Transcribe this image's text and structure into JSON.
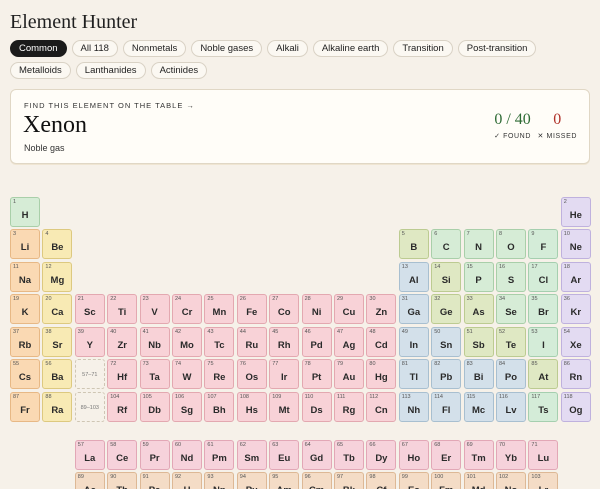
{
  "app": {
    "title": "Element Hunter"
  },
  "filters": [
    "Common",
    "All 118",
    "Nonmetals",
    "Noble gases",
    "Alkali",
    "Alkaline earth",
    "Transition",
    "Post-transition",
    "Metalloids",
    "Lanthanides",
    "Actinides"
  ],
  "active_filter": "Common",
  "quiz": {
    "prompt": "FIND THIS ELEMENT ON THE TABLE →",
    "element_name": "Xenon",
    "element_category": "Noble gas",
    "found_score": "0 / 40",
    "found_label": "✓ FOUND",
    "missed_score": "0",
    "missed_label": "✕ MISSED"
  },
  "colors": {
    "nonmetal": "#d6ecd6",
    "noble": "#e3dbf2",
    "alkali": "#fad9b3",
    "alkaline": "#f8eab4",
    "transition": "#f8d2d7",
    "post": "#d3e0ea",
    "metalloid": "#dfe8c3",
    "halogen": "#d4ecd8",
    "lanthanide": "#f6d2db",
    "actinide": "#f4dcc6",
    "found_green": "#2e6b35",
    "missed_red": "#b0322a"
  },
  "elements": [
    [
      "1",
      "H",
      "nonmetal",
      1,
      1
    ],
    [
      "2",
      "He",
      "noble",
      1,
      18
    ],
    [
      "3",
      "Li",
      "alkali",
      2,
      1
    ],
    [
      "4",
      "Be",
      "alkaline",
      2,
      2
    ],
    [
      "5",
      "B",
      "metalloid",
      2,
      13
    ],
    [
      "6",
      "C",
      "nonmetal",
      2,
      14
    ],
    [
      "7",
      "N",
      "nonmetal",
      2,
      15
    ],
    [
      "8",
      "O",
      "nonmetal",
      2,
      16
    ],
    [
      "9",
      "F",
      "halogen",
      2,
      17
    ],
    [
      "10",
      "Ne",
      "noble",
      2,
      18
    ],
    [
      "11",
      "Na",
      "alkali",
      3,
      1
    ],
    [
      "12",
      "Mg",
      "alkaline",
      3,
      2
    ],
    [
      "13",
      "Al",
      "post",
      3,
      13
    ],
    [
      "14",
      "Si",
      "metalloid",
      3,
      14
    ],
    [
      "15",
      "P",
      "nonmetal",
      3,
      15
    ],
    [
      "16",
      "S",
      "nonmetal",
      3,
      16
    ],
    [
      "17",
      "Cl",
      "halogen",
      3,
      17
    ],
    [
      "18",
      "Ar",
      "noble",
      3,
      18
    ],
    [
      "19",
      "K",
      "alkali",
      4,
      1
    ],
    [
      "20",
      "Ca",
      "alkaline",
      4,
      2
    ],
    [
      "21",
      "Sc",
      "transition",
      4,
      3
    ],
    [
      "22",
      "Ti",
      "transition",
      4,
      4
    ],
    [
      "23",
      "V",
      "transition",
      4,
      5
    ],
    [
      "24",
      "Cr",
      "transition",
      4,
      6
    ],
    [
      "25",
      "Mn",
      "transition",
      4,
      7
    ],
    [
      "26",
      "Fe",
      "transition",
      4,
      8
    ],
    [
      "27",
      "Co",
      "transition",
      4,
      9
    ],
    [
      "28",
      "Ni",
      "transition",
      4,
      10
    ],
    [
      "29",
      "Cu",
      "transition",
      4,
      11
    ],
    [
      "30",
      "Zn",
      "transition",
      4,
      12
    ],
    [
      "31",
      "Ga",
      "post",
      4,
      13
    ],
    [
      "32",
      "Ge",
      "metalloid",
      4,
      14
    ],
    [
      "33",
      "As",
      "metalloid",
      4,
      15
    ],
    [
      "34",
      "Se",
      "nonmetal",
      4,
      16
    ],
    [
      "35",
      "Br",
      "halogen",
      4,
      17
    ],
    [
      "36",
      "Kr",
      "noble",
      4,
      18
    ],
    [
      "37",
      "Rb",
      "alkali",
      5,
      1
    ],
    [
      "38",
      "Sr",
      "alkaline",
      5,
      2
    ],
    [
      "39",
      "Y",
      "transition",
      5,
      3
    ],
    [
      "40",
      "Zr",
      "transition",
      5,
      4
    ],
    [
      "41",
      "Nb",
      "transition",
      5,
      5
    ],
    [
      "42",
      "Mo",
      "transition",
      5,
      6
    ],
    [
      "43",
      "Tc",
      "transition",
      5,
      7
    ],
    [
      "44",
      "Ru",
      "transition",
      5,
      8
    ],
    [
      "45",
      "Rh",
      "transition",
      5,
      9
    ],
    [
      "46",
      "Pd",
      "transition",
      5,
      10
    ],
    [
      "47",
      "Ag",
      "transition",
      5,
      11
    ],
    [
      "48",
      "Cd",
      "transition",
      5,
      12
    ],
    [
      "49",
      "In",
      "post",
      5,
      13
    ],
    [
      "50",
      "Sn",
      "post",
      5,
      14
    ],
    [
      "51",
      "Sb",
      "metalloid",
      5,
      15
    ],
    [
      "52",
      "Te",
      "metalloid",
      5,
      16
    ],
    [
      "53",
      "I",
      "halogen",
      5,
      17
    ],
    [
      "54",
      "Xe",
      "noble",
      5,
      18
    ],
    [
      "55",
      "Cs",
      "alkali",
      6,
      1
    ],
    [
      "56",
      "Ba",
      "alkaline",
      6,
      2
    ],
    [
      "72",
      "Hf",
      "transition",
      6,
      4
    ],
    [
      "73",
      "Ta",
      "transition",
      6,
      5
    ],
    [
      "74",
      "W",
      "transition",
      6,
      6
    ],
    [
      "75",
      "Re",
      "transition",
      6,
      7
    ],
    [
      "76",
      "Os",
      "transition",
      6,
      8
    ],
    [
      "77",
      "Ir",
      "transition",
      6,
      9
    ],
    [
      "78",
      "Pt",
      "transition",
      6,
      10
    ],
    [
      "79",
      "Au",
      "transition",
      6,
      11
    ],
    [
      "80",
      "Hg",
      "transition",
      6,
      12
    ],
    [
      "81",
      "Tl",
      "post",
      6,
      13
    ],
    [
      "82",
      "Pb",
      "post",
      6,
      14
    ],
    [
      "83",
      "Bi",
      "post",
      6,
      15
    ],
    [
      "84",
      "Po",
      "post",
      6,
      16
    ],
    [
      "85",
      "At",
      "metalloid",
      6,
      17
    ],
    [
      "86",
      "Rn",
      "noble",
      6,
      18
    ],
    [
      "87",
      "Fr",
      "alkali",
      7,
      1
    ],
    [
      "88",
      "Ra",
      "alkaline",
      7,
      2
    ],
    [
      "104",
      "Rf",
      "transition",
      7,
      4
    ],
    [
      "105",
      "Db",
      "transition",
      7,
      5
    ],
    [
      "106",
      "Sg",
      "transition",
      7,
      6
    ],
    [
      "107",
      "Bh",
      "transition",
      7,
      7
    ],
    [
      "108",
      "Hs",
      "transition",
      7,
      8
    ],
    [
      "109",
      "Mt",
      "transition",
      7,
      9
    ],
    [
      "110",
      "Ds",
      "transition",
      7,
      10
    ],
    [
      "111",
      "Rg",
      "transition",
      7,
      11
    ],
    [
      "112",
      "Cn",
      "transition",
      7,
      12
    ],
    [
      "113",
      "Nh",
      "post",
      7,
      13
    ],
    [
      "114",
      "Fl",
      "post",
      7,
      14
    ],
    [
      "115",
      "Mc",
      "post",
      7,
      15
    ],
    [
      "116",
      "Lv",
      "post",
      7,
      16
    ],
    [
      "117",
      "Ts",
      "halogen",
      7,
      17
    ],
    [
      "118",
      "Og",
      "noble",
      7,
      18
    ],
    [
      "57",
      "La",
      "lanthanide",
      9,
      3
    ],
    [
      "58",
      "Ce",
      "lanthanide",
      9,
      4
    ],
    [
      "59",
      "Pr",
      "lanthanide",
      9,
      5
    ],
    [
      "60",
      "Nd",
      "lanthanide",
      9,
      6
    ],
    [
      "61",
      "Pm",
      "lanthanide",
      9,
      7
    ],
    [
      "62",
      "Sm",
      "lanthanide",
      9,
      8
    ],
    [
      "63",
      "Eu",
      "lanthanide",
      9,
      9
    ],
    [
      "64",
      "Gd",
      "lanthanide",
      9,
      10
    ],
    [
      "65",
      "Tb",
      "lanthanide",
      9,
      11
    ],
    [
      "66",
      "Dy",
      "lanthanide",
      9,
      12
    ],
    [
      "67",
      "Ho",
      "lanthanide",
      9,
      13
    ],
    [
      "68",
      "Er",
      "lanthanide",
      9,
      14
    ],
    [
      "69",
      "Tm",
      "lanthanide",
      9,
      15
    ],
    [
      "70",
      "Yb",
      "lanthanide",
      9,
      16
    ],
    [
      "71",
      "Lu",
      "lanthanide",
      9,
      17
    ],
    [
      "89",
      "Ac",
      "actinide",
      10,
      3
    ],
    [
      "90",
      "Th",
      "actinide",
      10,
      4
    ],
    [
      "91",
      "Pa",
      "actinide",
      10,
      5
    ],
    [
      "92",
      "U",
      "actinide",
      10,
      6
    ],
    [
      "93",
      "Np",
      "actinide",
      10,
      7
    ],
    [
      "94",
      "Pu",
      "actinide",
      10,
      8
    ],
    [
      "95",
      "Am",
      "actinide",
      10,
      9
    ],
    [
      "96",
      "Cm",
      "actinide",
      10,
      10
    ],
    [
      "97",
      "Bk",
      "actinide",
      10,
      11
    ],
    [
      "98",
      "Cf",
      "actinide",
      10,
      12
    ],
    [
      "99",
      "Es",
      "actinide",
      10,
      13
    ],
    [
      "100",
      "Fm",
      "actinide",
      10,
      14
    ],
    [
      "101",
      "Md",
      "actinide",
      10,
      15
    ],
    [
      "102",
      "No",
      "actinide",
      10,
      16
    ],
    [
      "103",
      "Lr",
      "actinide",
      10,
      17
    ]
  ],
  "placeholders": [
    [
      "57–71",
      6,
      3
    ],
    [
      "89–103",
      7,
      3
    ]
  ]
}
